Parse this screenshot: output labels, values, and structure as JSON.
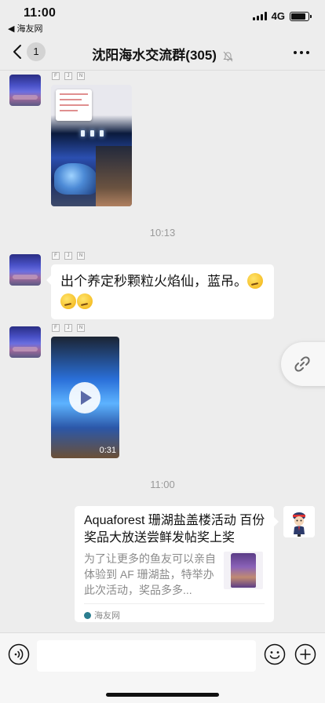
{
  "status_bar": {
    "time": "11:00",
    "back_app": "◀ 海友网",
    "network": "4G",
    "signal_bars": 4,
    "battery_level": 0.85
  },
  "nav": {
    "back_count": "1",
    "title": "沈阳海水交流群(305)",
    "muted": true
  },
  "messages": [
    {
      "type": "image",
      "side": "left",
      "sender_badges": [
        "F",
        "J",
        "N"
      ],
      "description_icon": "aquarium-photo"
    },
    {
      "type": "timestamp",
      "text": "10:13"
    },
    {
      "type": "text",
      "side": "left",
      "sender_badges": [
        "F",
        "J",
        "N"
      ],
      "text": "出个养定秒颗粒火焰仙，蓝吊。",
      "emoji_count": 3
    },
    {
      "type": "video",
      "side": "left",
      "sender_badges": [
        "F",
        "J",
        "N"
      ],
      "duration": "0:31"
    },
    {
      "type": "timestamp",
      "text": "11:00"
    },
    {
      "type": "link_card",
      "side": "right",
      "title": "Aquaforest 珊湖盐盖楼活动 百份奖品大放送尝鲜发帖奖上奖",
      "description": "为了让更多的鱼友可以亲自体验到 AF 珊湖盐，特举办此次活动，奖品多多...",
      "source": "海友网"
    }
  ],
  "timestamps": {
    "first": "10:13",
    "second": "11:00"
  },
  "colors": {
    "background": "#ededed",
    "bubble": "#ffffff",
    "muted_text": "#9a9a9a"
  }
}
